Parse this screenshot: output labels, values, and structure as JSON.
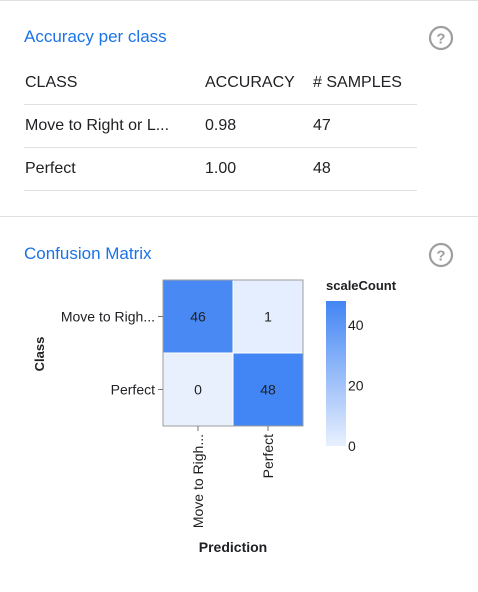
{
  "accuracy": {
    "title": "Accuracy per class",
    "columns": [
      "CLASS",
      "ACCURACY",
      "# SAMPLES"
    ],
    "rows": [
      {
        "class": "Move to Right or L...",
        "accuracy": "0.98",
        "samples": "47"
      },
      {
        "class": "Perfect",
        "accuracy": "1.00",
        "samples": "48"
      }
    ],
    "help_icon": "help-circle-icon"
  },
  "confusion": {
    "title": "Confusion Matrix",
    "help_icon": "help-circle-icon",
    "y_label": "Class",
    "x_label": "Prediction",
    "row_labels": [
      "Move to Righ...",
      "Perfect"
    ],
    "col_labels": [
      "Move to Righ...",
      "Perfect"
    ],
    "legend_title": "scaleCount",
    "legend_ticks": [
      "40",
      "20",
      "0"
    ],
    "colors": {
      "high": "#4285f4",
      "low": "#e8f0fe",
      "text": "#202124"
    }
  },
  "chart_data": {
    "type": "heatmap",
    "rows": [
      "Move to Righ...",
      "Perfect"
    ],
    "cols": [
      "Move to Righ...",
      "Perfect"
    ],
    "values": [
      [
        46,
        1
      ],
      [
        0,
        48
      ]
    ],
    "xlabel": "Prediction",
    "ylabel": "Class",
    "legend_title": "scaleCount",
    "color_range": [
      0,
      48
    ],
    "legend_ticks": [
      40,
      20,
      0
    ]
  }
}
